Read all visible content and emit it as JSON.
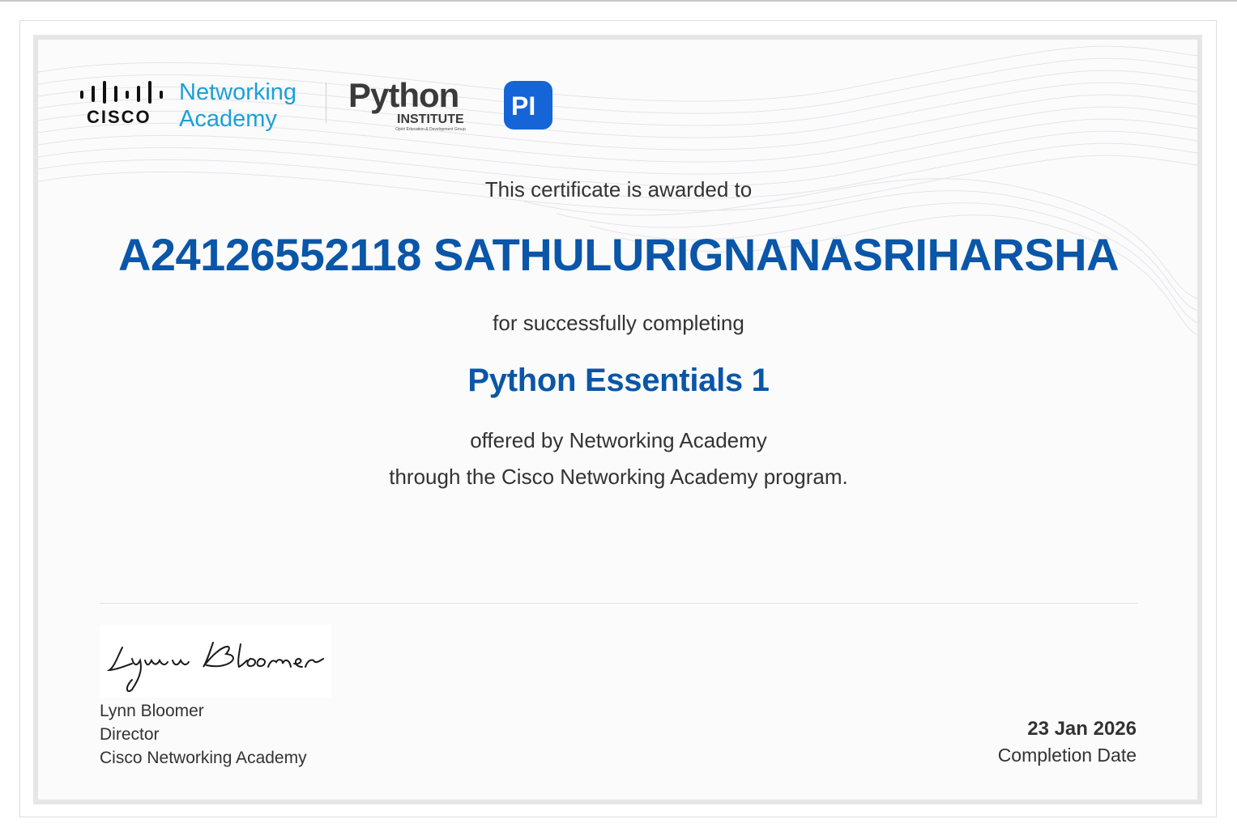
{
  "logos": {
    "cisco_wordmark": "CISCO",
    "academy_line1": "Networking",
    "academy_line2": "Academy",
    "python_logo_text": "Python",
    "python_logo_sub": "INSTITUTE",
    "python_logo_tagline": "Open Education & Development Group",
    "python_badge": "PI"
  },
  "certificate": {
    "awarded_line": "This certificate is awarded to",
    "recipient": "A24126552118 SATHULURIGNANASRIHARSHA",
    "completing_line": "for successfully completing",
    "course": "Python Essentials 1",
    "offered_line": "offered by Networking Academy",
    "through_line": "through the Cisco Networking Academy program."
  },
  "signatory": {
    "signature_text": "Lynn Bloomer",
    "name": "Lynn Bloomer",
    "title": "Director",
    "organization": "Cisco Networking Academy"
  },
  "completion": {
    "date": "23 Jan 2026",
    "label": "Completion Date"
  },
  "colors": {
    "accent_blue": "#0a56a8",
    "academy_cyan": "#1ba0d7",
    "text_gray": "#333333"
  }
}
